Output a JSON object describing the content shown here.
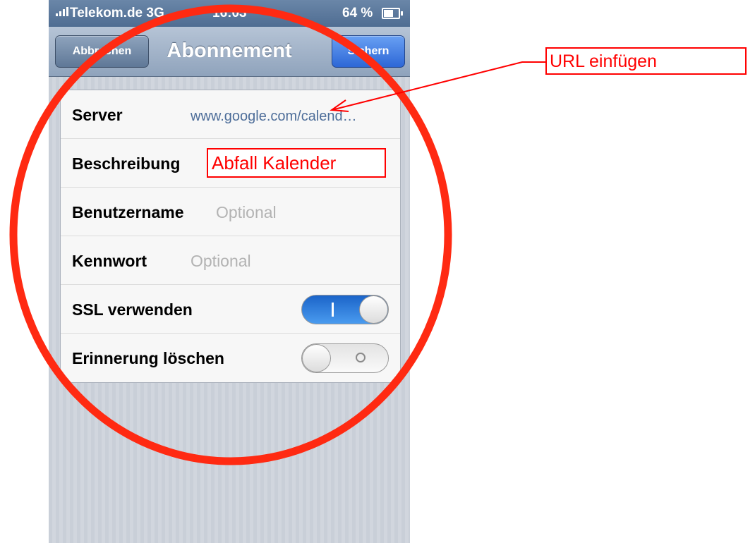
{
  "status_bar": {
    "carrier": "Telekom.de",
    "network": "3G",
    "time": "16:03",
    "battery": "64 %"
  },
  "nav": {
    "title": "Abonnement",
    "cancel_label": "Abbrechen",
    "save_label": "Sichern"
  },
  "form": {
    "server": {
      "label": "Server",
      "value": "www.google.com/calend…"
    },
    "description": {
      "label": "Beschreibung"
    },
    "username": {
      "label": "Benutzername",
      "placeholder": "Optional"
    },
    "password": {
      "label": "Kennwort",
      "placeholder": "Optional"
    },
    "ssl": {
      "label": "SSL verwenden",
      "on": true
    },
    "remove_alarms": {
      "label": "Erinnerung löschen",
      "on": false
    }
  },
  "annotations": {
    "url_hint": "URL einfügen",
    "description_value": "Abfall Kalender",
    "color": "#ff0000"
  },
  "colors": {
    "accent_blue": "#2d67d6",
    "link_blue": "#4d6d99"
  }
}
